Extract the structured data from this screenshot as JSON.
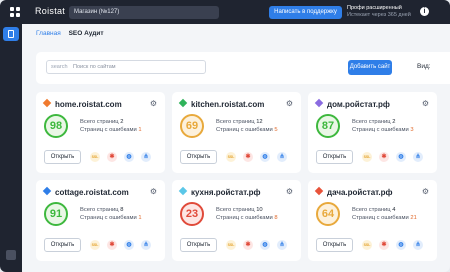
{
  "topbar": {
    "brand": "Roistat",
    "shop_label": "Магазин (№127)",
    "support_label": "Написать в поддержку",
    "plan_title": "Профи расширенный",
    "plan_sub": "Истекает через 365 дней",
    "info_icon": "info-icon"
  },
  "breadcrumb": {
    "home": "Главная",
    "current": "SEO Аудит"
  },
  "toolbar": {
    "search_label": "search",
    "search_placeholder": "Поиск по сайтам",
    "add_label": "Добавить сайт",
    "view_label": "Вид:"
  },
  "labels": {
    "pages_total": "Всего страниц",
    "pages_errors": "Страниц с ошибками",
    "open": "Открыть",
    "ssl": "SSL"
  },
  "sites": [
    {
      "name": "home.roistat.com",
      "score": "98",
      "total": "2",
      "errors": "1",
      "marker_color": "#f07a2e",
      "score_color": "#3eb83e",
      "score_bg": "#eaf7e6"
    },
    {
      "name": "kitchen.roistat.com",
      "score": "69",
      "total": "12",
      "errors": "5",
      "marker_color": "#2fb35a",
      "score_color": "#e8a93c",
      "score_bg": "#fdf1dc"
    },
    {
      "name": "дом.ройстат.рф",
      "score": "87",
      "total": "2",
      "errors": "3",
      "marker_color": "#8a6be0",
      "score_color": "#3eb83e",
      "score_bg": "#eaf7e6"
    },
    {
      "name": "cottage.roistat.com",
      "score": "91",
      "total": "8",
      "errors": "1",
      "marker_color": "#2f7ee8",
      "score_color": "#3eb83e",
      "score_bg": "#eaf7e6"
    },
    {
      "name": "кухня.ройстат.рф",
      "score": "23",
      "total": "10",
      "errors": "8",
      "marker_color": "#5bc7e8",
      "score_color": "#e04a3a",
      "score_bg": "#fde6e4"
    },
    {
      "name": "дача.ройстат.рф",
      "score": "64",
      "total": "4",
      "errors": "21",
      "marker_color": "#e8533a",
      "score_color": "#e8a93c",
      "score_bg": "#fdf1dc"
    }
  ]
}
